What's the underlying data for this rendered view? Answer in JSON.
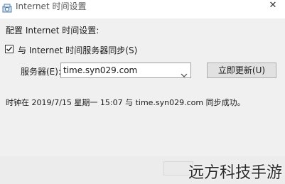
{
  "window": {
    "title": "Internet 时间设置",
    "close_glyph": "✕",
    "icon": "globe-clock-icon"
  },
  "config_label": "配置 Internet 时间设置:",
  "sync": {
    "checked": true,
    "label": "与 Internet 时间服务器同步(S)"
  },
  "server": {
    "label": "服务器(E):",
    "value": "time.syn029.com"
  },
  "update_button": "立即更新(U)",
  "status": "时钟在 2019/7/15 星期一 15:07 与 time.syn029.com 同步成功。",
  "watermark": "远方科技手游"
}
